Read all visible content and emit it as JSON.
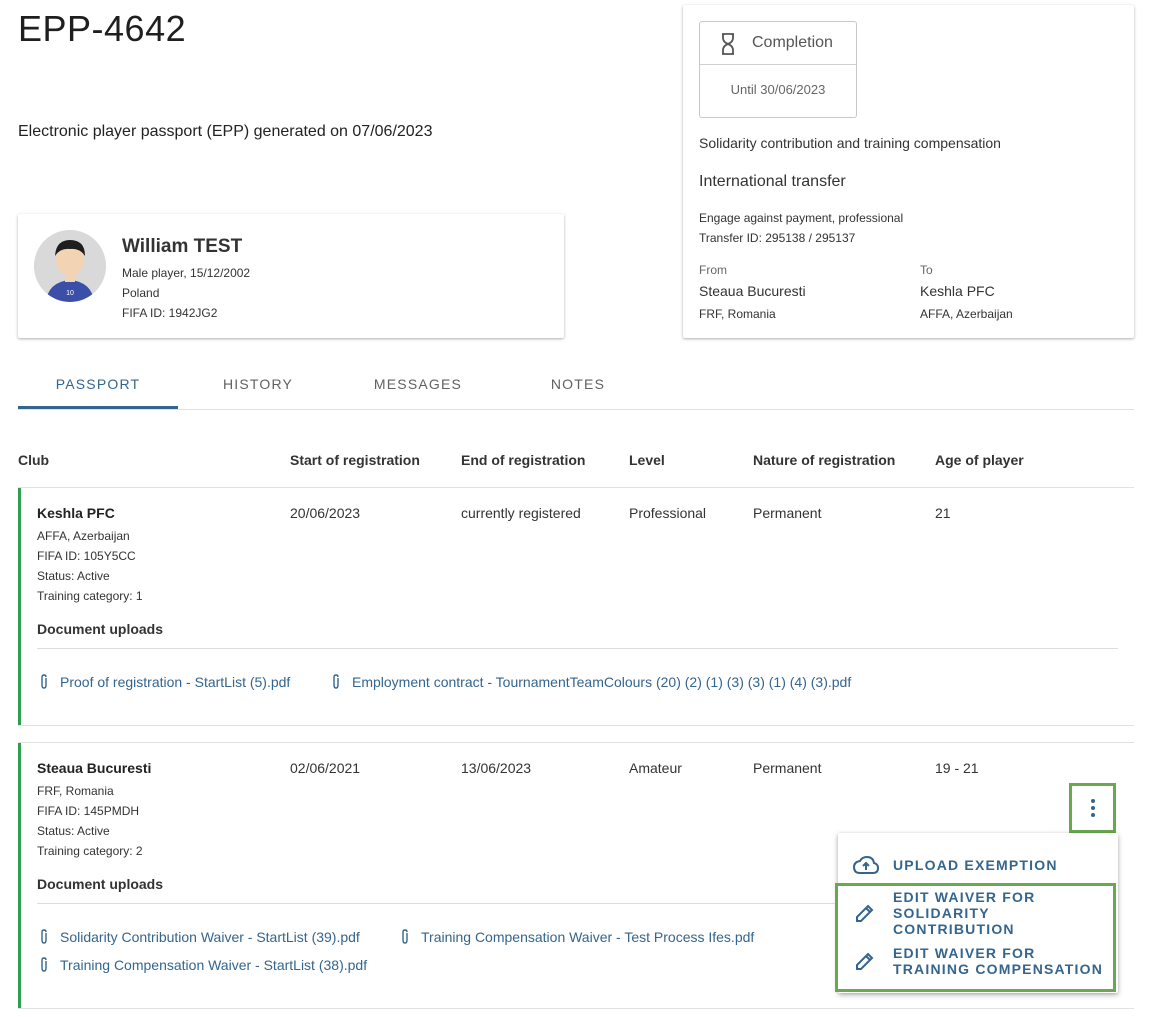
{
  "header": {
    "title": "EPP-4642",
    "generated": "Electronic player passport (EPP) generated on 07/06/2023"
  },
  "player": {
    "name": "William TEST",
    "line1": "Male player, 15/12/2002",
    "line2": "Poland",
    "line3": "FIFA ID: 1942JG2",
    "shirt_number": "10"
  },
  "transfer": {
    "completion_label": "Completion",
    "completion_until": "Until 30/06/2023",
    "solidarity": "Solidarity contribution and training compensation",
    "type": "International transfer",
    "detail1": "Engage against payment, professional",
    "detail2": "Transfer ID: 295138 / 295137",
    "from_label": "From",
    "from_club": "Steaua Bucuresti",
    "from_assoc": "FRF, Romania",
    "to_label": "To",
    "to_club": "Keshla PFC",
    "to_assoc": "AFFA, Azerbaijan"
  },
  "tabs": [
    "PASSPORT",
    "HISTORY",
    "MESSAGES",
    "NOTES"
  ],
  "table": {
    "headers": [
      "Club",
      "Start of registration",
      "End of registration",
      "Level",
      "Nature of registration",
      "Age of player"
    ],
    "rows": [
      {
        "club": "Keshla PFC",
        "assoc": "AFFA, Azerbaijan",
        "fifa_id": "FIFA ID: 105Y5CC",
        "status": "Status: Active",
        "training": "Training category: 1",
        "start": "20/06/2023",
        "end": "currently registered",
        "level": "Professional",
        "nature": "Permanent",
        "age": "21",
        "doc_title": "Document uploads",
        "docs": [
          "Proof of registration - StartList (5).pdf",
          "Employment contract - TournamentTeamColours (20) (2) (1) (3) (3) (1) (4) (3).pdf"
        ]
      },
      {
        "club": "Steaua Bucuresti",
        "assoc": "FRF, Romania",
        "fifa_id": "FIFA ID: 145PMDH",
        "status": "Status: Active",
        "training": "Training category: 2",
        "start": "02/06/2021",
        "end": "13/06/2023",
        "level": "Amateur",
        "nature": "Permanent",
        "age": "19 - 21",
        "doc_title": "Document uploads",
        "docs": [
          "Solidarity Contribution Waiver - StartList (39).pdf",
          "Training Compensation Waiver - Test Process Ifes.pdf",
          "Training Compensation Waiver - StartList (38).pdf"
        ]
      }
    ]
  },
  "menu": {
    "upload": "UPLOAD EXEMPTION",
    "edit_solidarity_1": "EDIT WAIVER FOR",
    "edit_solidarity_2": "SOLIDARITY",
    "edit_solidarity_3": "CONTRIBUTION",
    "edit_training_1": "EDIT WAIVER FOR",
    "edit_training_2": "TRAINING COMPENSATION"
  },
  "colors": {
    "accent": "#34658e",
    "row_border": "#2e9e4f",
    "highlight": "#6aa84f"
  }
}
